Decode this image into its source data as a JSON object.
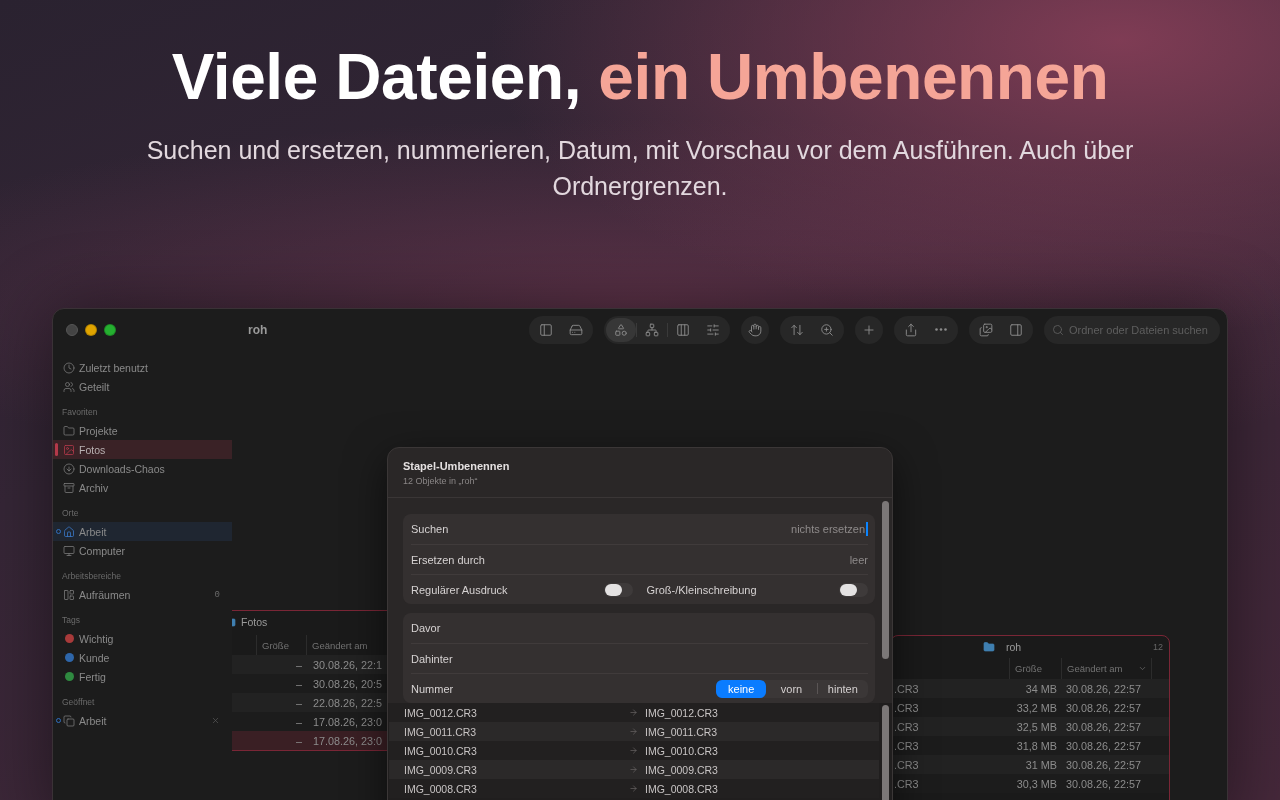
{
  "hero": {
    "title": [
      {
        "text": "Viele Dateien,",
        "accent": false
      },
      {
        "text": "ein Umbenennen",
        "accent": true
      }
    ],
    "subtitle": "Suchen und ersetzen, nummerieren, Datum, mit Vorschau vor dem Ausführen. Auch über Ordnergrenzen."
  },
  "window": {
    "title": "roh",
    "traffic_lights": [
      {
        "kind": "close",
        "disabled": true
      },
      {
        "kind": "minimize",
        "disabled": false
      },
      {
        "kind": "zoom",
        "disabled": false
      }
    ]
  },
  "sidebar": {
    "sections": [
      {
        "items": [
          {
            "label": "Zuletzt benutzt",
            "selected": false,
            "active": false,
            "open": false,
            "closable": false
          },
          {
            "label": "Geteilt",
            "selected": false,
            "active": false,
            "open": false,
            "closable": false
          }
        ]
      },
      {
        "header": "Favoriten",
        "items": [
          {
            "label": "Projekte",
            "selected": false,
            "active": false,
            "open": false,
            "closable": false
          },
          {
            "label": "Fotos",
            "selected": true,
            "active": false,
            "open": false,
            "closable": false
          },
          {
            "label": "Downloads-Chaos",
            "selected": false,
            "active": false,
            "open": false,
            "closable": false
          },
          {
            "label": "Archiv",
            "selected": false,
            "active": false,
            "open": false,
            "closable": false
          }
        ]
      },
      {
        "header": "Orte",
        "items": [
          {
            "label": "Arbeit",
            "selected": false,
            "active": true,
            "open": true,
            "closable": false
          },
          {
            "label": "Computer",
            "selected": false,
            "active": false,
            "open": false,
            "closable": false
          }
        ]
      },
      {
        "header": "Arbeitsbereiche",
        "items": [
          {
            "label": "Aufräumen",
            "count": "0",
            "selected": false,
            "active": false,
            "open": false,
            "closable": false
          }
        ]
      },
      {
        "header": "Tags",
        "items": [
          {
            "label": "Wichtig",
            "color": "#a83a3a",
            "selected": false,
            "active": false,
            "open": false,
            "closable": false
          },
          {
            "label": "Kunde",
            "color": "#2e66aa",
            "selected": false,
            "active": false,
            "open": false,
            "closable": false
          },
          {
            "label": "Fertig",
            "color": "#2f8a40",
            "selected": false,
            "active": false,
            "open": false,
            "closable": false
          }
        ]
      },
      {
        "header": "Geöffnet",
        "items": [
          {
            "label": "Arbeit",
            "selected": false,
            "active": false,
            "open": true,
            "closable": true
          }
        ]
      }
    ]
  },
  "toolbar": {
    "groups": [
      {
        "buttons": [
          {
            "selected": false
          },
          {
            "selected": false
          }
        ]
      },
      {
        "buttons": [
          {
            "selected": true
          },
          {
            "selected": false
          },
          {
            "selected": false
          },
          {
            "selected": false
          }
        ]
      },
      {
        "buttons": [
          {
            "selected": false
          }
        ]
      },
      {
        "buttons": [
          {
            "selected": false
          },
          {
            "selected": false
          }
        ]
      },
      {
        "buttons": [
          {
            "selected": false
          }
        ]
      },
      {
        "buttons": [
          {
            "selected": false
          },
          {
            "selected": false
          }
        ]
      },
      {
        "buttons": [
          {
            "selected": false
          },
          {
            "selected": false
          }
        ]
      }
    ],
    "search": {
      "placeholder": "Ordner oder Dateien suchen"
    }
  },
  "panes": [
    {
      "title": "Fotos",
      "columns": [
        {
          "label": "Größe",
          "sorted": false
        },
        {
          "label": "Geändert am",
          "sorted": false
        }
      ],
      "rows": [
        {
          "size": "–",
          "modified": "30.08.26, 22:1",
          "selected": false
        },
        {
          "size": "–",
          "modified": "30.08.26, 20:5",
          "selected": false
        },
        {
          "size": "–",
          "modified": "22.08.26, 22:5",
          "selected": false
        },
        {
          "size": "–",
          "modified": "17.08.26, 23:0",
          "selected": false
        },
        {
          "size": "–",
          "modified": "17.08.26, 23:0",
          "selected": true
        }
      ]
    },
    {
      "title": "roh",
      "count": "12",
      "columns": [
        {
          "label": "Größe",
          "sorted": false
        },
        {
          "label": "Geändert am",
          "sorted": true
        }
      ],
      "rows": [
        {
          "name": ".CR3",
          "size": "34 MB",
          "modified": "30.08.26, 22:57",
          "selected": false
        },
        {
          "name": ".CR3",
          "size": "33,2 MB",
          "modified": "30.08.26, 22:57",
          "selected": false
        },
        {
          "name": ".CR3",
          "size": "32,5 MB",
          "modified": "30.08.26, 22:57",
          "selected": false
        },
        {
          "name": ".CR3",
          "size": "31,8 MB",
          "modified": "30.08.26, 22:57",
          "selected": false
        },
        {
          "name": ".CR3",
          "size": "31 MB",
          "modified": "30.08.26, 22:57",
          "selected": false
        },
        {
          "name": ".CR3",
          "size": "30,3 MB",
          "modified": "30.08.26, 22:57",
          "selected": false
        }
      ]
    }
  ],
  "dialog": {
    "title": "Stapel-Umbenennen",
    "subtitle": "12 Objekte in „roh“",
    "groups": [
      {
        "rows": [
          {
            "kind": "field",
            "label": "Suchen",
            "placeholder": "nichts ersetzen",
            "focused": true
          },
          {
            "kind": "field",
            "label": "Ersetzen durch",
            "placeholder": "leer",
            "focused": false
          },
          {
            "kind": "toggles",
            "toggles": [
              {
                "label": "Regulärer Ausdruck",
                "on": false
              },
              {
                "label": "Groß-/Kleinschreibung",
                "on": false
              }
            ]
          }
        ]
      },
      {
        "rows": [
          {
            "kind": "field",
            "label": "Davor",
            "focused": false
          },
          {
            "kind": "field",
            "label": "Dahinter",
            "focused": false
          },
          {
            "kind": "segmented",
            "label": "Nummer",
            "options": [
              {
                "label": "keine",
                "selected": true
              },
              {
                "label": "vorn",
                "selected": false
              },
              {
                "label": "hinten",
                "selected": false
              }
            ]
          }
        ]
      }
    ],
    "preview": [
      {
        "old": "IMG_0012.CR3",
        "new": "IMG_0012.CR3"
      },
      {
        "old": "IMG_0011.CR3",
        "new": "IMG_0011.CR3"
      },
      {
        "old": "IMG_0010.CR3",
        "new": "IMG_0010.CR3"
      },
      {
        "old": "IMG_0009.CR3",
        "new": "IMG_0009.CR3"
      },
      {
        "old": "IMG_0008.CR3",
        "new": "IMG_0008.CR3"
      }
    ]
  }
}
